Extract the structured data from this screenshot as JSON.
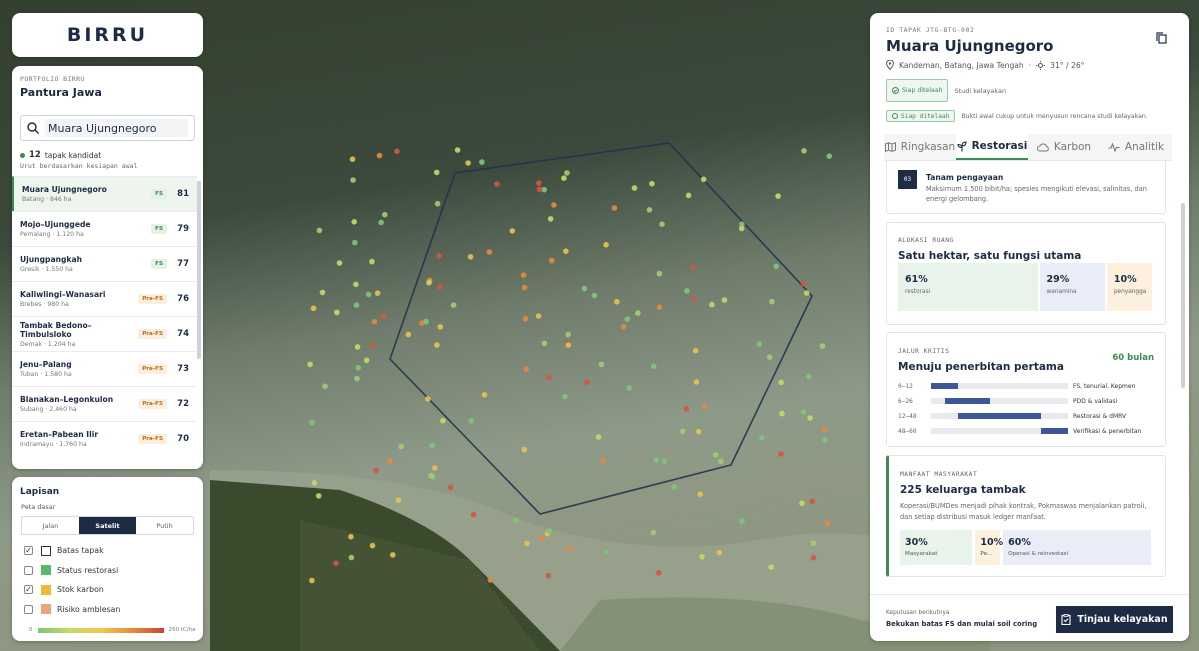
{
  "brand": {
    "logo": "BIRRU"
  },
  "portfolio": {
    "label": "PORTFOLIO BIRRU",
    "name": "Pantura Jawa",
    "search_value": "Muara Ujungnegoro",
    "candidate_count": "12",
    "candidate_label": "tapak kandidat",
    "sort_note": "Urut berdasarkan kesiapan awal",
    "sites": [
      {
        "name": "Muara Ujungnegoro",
        "sub": "Batang · 846 ha",
        "badge": "FS",
        "score": "81"
      },
      {
        "name": "Mojo–Ujunggede",
        "sub": "Pemalang · 1.120 ha",
        "badge": "FS",
        "score": "79"
      },
      {
        "name": "Ujungpangkah",
        "sub": "Gresik · 1.550 ha",
        "badge": "FS",
        "score": "77"
      },
      {
        "name": "Kaliwlingi–Wanasari",
        "sub": "Brebes · 980 ha",
        "badge": "Pra-FS",
        "score": "76"
      },
      {
        "name": "Tambak Bedono–Timbulsloko",
        "sub": "Demak · 1.204 ha",
        "badge": "Pra-FS",
        "score": "74"
      },
      {
        "name": "Jenu–Palang",
        "sub": "Tuban · 1.580 ha",
        "badge": "Pra-FS",
        "score": "73"
      },
      {
        "name": "Blanakan–Legonkulon",
        "sub": "Subang · 2.460 ha",
        "badge": "Pra-FS",
        "score": "72"
      },
      {
        "name": "Eretan–Pabean Ilir",
        "sub": "Indramayu · 1.760 ha",
        "badge": "Pra-FS",
        "score": "70"
      }
    ]
  },
  "layers": {
    "title": "Lapisan",
    "basemap_label": "Peta dasar",
    "basemaps": [
      "Jalan",
      "Satelit",
      "Putih"
    ],
    "active_basemap": "Satelit",
    "items": [
      {
        "label": "Batas tapak",
        "checked": true,
        "color": "#ffffff"
      },
      {
        "label": "Status restorasi",
        "checked": false,
        "color": "#5cb86a"
      },
      {
        "label": "Stok karbon",
        "checked": true,
        "color": "#efb93a"
      },
      {
        "label": "Risiko amblesan",
        "checked": false,
        "color": "#e9a57c"
      }
    ],
    "legend_min": "0",
    "legend_max": "250 tC/ha"
  },
  "site": {
    "id_label": "ID TAPAK JTG-BTG-002",
    "name": "Muara Ujungnegoro",
    "location": "Kandeman, Batang, Jawa Tengah",
    "weather": "31° / 26°",
    "status_pill": "Siap ditelaah",
    "status_text": "Studi kelayakan",
    "status_pill2": "Siap ditelaah",
    "status_note": "Bukti awal cukup untuk menyusun rencana studi kelayakan.",
    "tabs": [
      "Ringkasan",
      "Restorasi",
      "Karbon",
      "Analitik"
    ],
    "active_tab": "Restorasi",
    "step": {
      "num": "03",
      "title": "Tanam pengayaan",
      "desc": "Maksimum 1.500 bibit/ha; spesies mengikuti elevasi, salinitas, dan energi gelombang."
    },
    "allocation": {
      "label": "ALOKASI RUANG",
      "title": "Satu hektar, satu fungsi utama",
      "items": [
        {
          "value": "61%",
          "label": "restorasi",
          "pct": 61,
          "color": "#e8f3ea"
        },
        {
          "value": "29%",
          "label": "wanamina",
          "pct": 29,
          "color": "#e8edf7"
        },
        {
          "value": "10%",
          "label": "penyangga",
          "pct": 10,
          "color": "#fdf0dd"
        }
      ]
    },
    "critical_path": {
      "label": "JALUR KRITIS",
      "title": "Menuju penerbitan pertama",
      "duration": "60 bulan",
      "total": 60,
      "items": [
        {
          "range": "0–12",
          "name": "FS, tenurial, Kepmen",
          "start": 0,
          "end": 12
        },
        {
          "range": "6–26",
          "name": "PDD & validasi",
          "start": 6,
          "end": 26
        },
        {
          "range": "12–48",
          "name": "Restorasi & dMRV",
          "start": 12,
          "end": 48
        },
        {
          "range": "48–60",
          "name": "Verifikasi & penerbitan",
          "start": 48,
          "end": 60
        }
      ]
    },
    "community": {
      "label": "MANFAAT MASYARAKAT",
      "title": "225 keluarga tambak",
      "desc": "Koperasi/BUMDes menjadi pihak kontrak, Pokmaswas menjalankan patroli, dan setiap distribusi masuk ledger manfaat.",
      "items": [
        {
          "value": "30%",
          "label": "Masyarakat",
          "pct": 30
        },
        {
          "value": "10%",
          "label": "Pe...",
          "pct": 10
        },
        {
          "value": "60%",
          "label": "Operasi & reinvestasi",
          "pct": 60
        }
      ]
    },
    "footer_label": "Keputusan berikutnya",
    "footer_text": "Bekukan batas FS dan mulai soil coring",
    "review_button": "Tinjau kelayakan"
  }
}
